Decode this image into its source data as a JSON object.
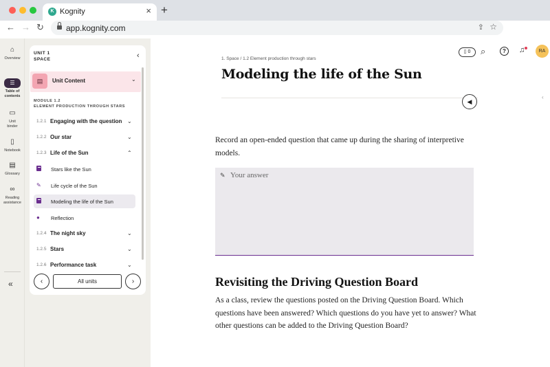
{
  "browser": {
    "tab_title": "Kognity",
    "favicon_letter": "K",
    "url": "app.kognity.com",
    "new_tab_symbol": "+",
    "close_symbol": "×"
  },
  "rail": {
    "items": [
      {
        "label": "Overview",
        "icon": "home-icon",
        "glyph": "⌂"
      },
      {
        "label": "Table of contents",
        "icon": "table-of-contents-icon",
        "glyph": "☰"
      },
      {
        "label": "Unit binder",
        "icon": "folder-icon",
        "glyph": "▭"
      },
      {
        "label": "Notebook",
        "icon": "notebook-icon",
        "glyph": "▯"
      },
      {
        "label": "Glossary",
        "icon": "glossary-icon",
        "glyph": "▤"
      },
      {
        "label": "Reading assistance",
        "icon": "glasses-icon",
        "glyph": "∞"
      }
    ],
    "collapse_glyph": "«"
  },
  "toc": {
    "unit_line1": "UNIT 1",
    "unit_line2": "SPACE",
    "unit_content_label": "Unit Content",
    "module_line1": "MODULE 1.2",
    "module_line2": "ELEMENT PRODUCTION THROUGH STARS",
    "sections": [
      {
        "num": "1.2.1",
        "title": "Engaging with the question"
      },
      {
        "num": "1.2.2",
        "title": "Our star"
      },
      {
        "num": "1.2.3",
        "title": "Life of the Sun"
      },
      {
        "num": "1.2.4",
        "title": "The night sky"
      },
      {
        "num": "1.2.5",
        "title": "Stars"
      },
      {
        "num": "1.2.6",
        "title": "Performance task"
      }
    ],
    "subsections": [
      {
        "title": "Stars like the Sun",
        "icon": "book-icon"
      },
      {
        "title": "Life cycle of the Sun",
        "icon": "pencil-icon"
      },
      {
        "title": "Modeling the life of the Sun",
        "icon": "book-icon"
      },
      {
        "title": "Reflection",
        "icon": "speech-bubble-icon"
      }
    ],
    "all_units_label": "All units"
  },
  "header": {
    "assignment_count": "0",
    "avatar_initials": "RA"
  },
  "page": {
    "breadcrumb": "1. Space / 1.2 Element production through stars",
    "title": "Modeling the life of the Sun",
    "prompt": "Record an open-ended question that came up during the sharing of interpretive models.",
    "answer_placeholder": "Your answer",
    "section_heading": "Revisiting the Driving Question Board",
    "section_body": "As a class, review the questions posted on the Driving Question Board. Which questions have been answered? Which questions do you have yet to answer? What other questions can be added to the Driving Question Board?"
  },
  "colors": {
    "accent_purple": "#6a2d8f",
    "unit_content_bg": "#fbe5e9",
    "avatar_bg": "#f5c25a",
    "notification_dot": "#e23e57"
  }
}
